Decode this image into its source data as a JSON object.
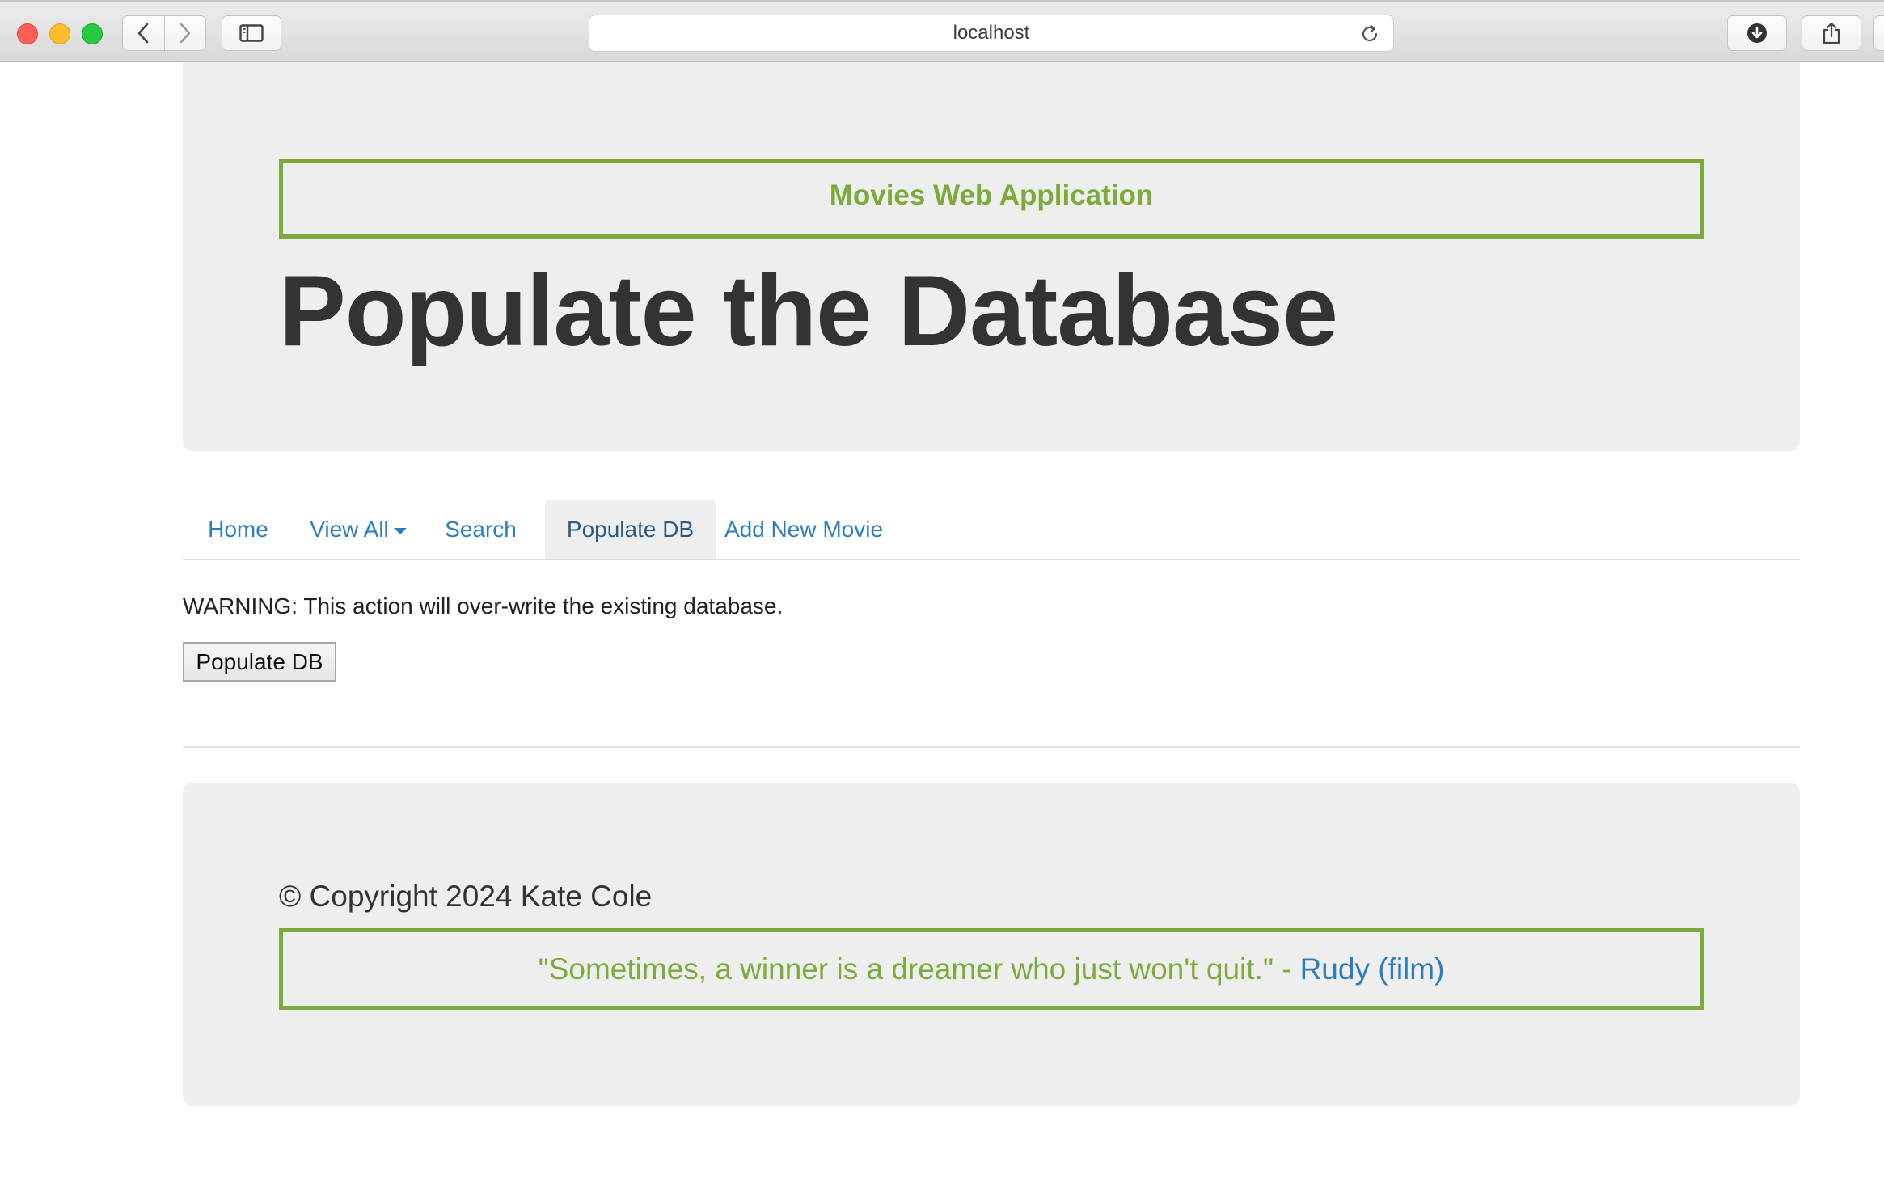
{
  "browser": {
    "url": "localhost",
    "icons": {
      "back": "chevron-left-icon",
      "forward": "chevron-right-icon",
      "sidebar": "sidebar-icon",
      "reload": "reload-icon",
      "download": "download-icon",
      "share": "share-icon"
    }
  },
  "header": {
    "app_title": "Movies Web Application",
    "page_title": "Populate the Database"
  },
  "nav": {
    "tabs": [
      {
        "label": "Home",
        "active": false
      },
      {
        "label": "View All",
        "active": false,
        "dropdown": true
      },
      {
        "label": "Search",
        "active": false
      },
      {
        "label": "Populate DB",
        "active": true
      },
      {
        "label": "Add New Movie",
        "active": false
      }
    ]
  },
  "main": {
    "warning": "WARNING: This action will over-write the existing database.",
    "populate_button": "Populate DB"
  },
  "footer": {
    "copyright": "© Copyright 2024 Kate Cole",
    "quote": "\"Sometimes, a winner is a dreamer who just won't quit.\" -",
    "quote_source": "Rudy (film)"
  },
  "colors": {
    "accent_green": "#7cab3b",
    "link_blue": "#2a7dbf",
    "panel_gray": "#eeeeee",
    "title_dark": "#333333"
  }
}
